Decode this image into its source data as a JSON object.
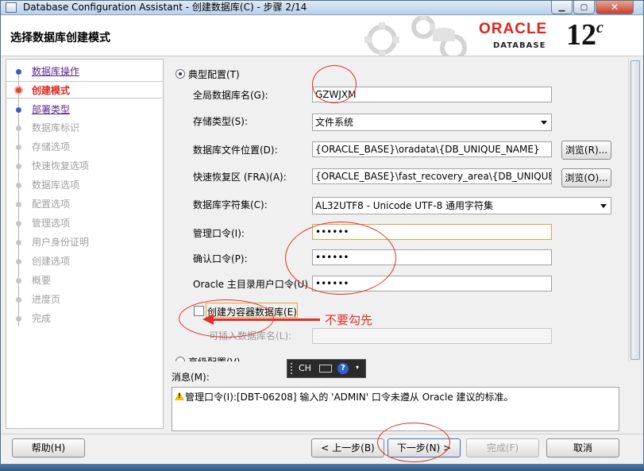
{
  "window": {
    "title": "Database Configuration Assistant - 创建数据库(C) - 步骤 2/14"
  },
  "header": {
    "page_title": "选择数据库创建模式",
    "brand": "ORACLE",
    "brand_sub": "DATABASE",
    "version_num": "12",
    "version_suffix": "c"
  },
  "steps": [
    {
      "label": "数据库操作",
      "state": "done"
    },
    {
      "label": "创建模式",
      "state": "current"
    },
    {
      "label": "部署类型",
      "state": "done"
    },
    {
      "label": "数据库标识",
      "state": "pending"
    },
    {
      "label": "存储选项",
      "state": "pending"
    },
    {
      "label": "快速恢复选项",
      "state": "pending"
    },
    {
      "label": "数据库选项",
      "state": "pending"
    },
    {
      "label": "配置选项",
      "state": "pending"
    },
    {
      "label": "管理选项",
      "state": "pending"
    },
    {
      "label": "用户身份证明",
      "state": "pending"
    },
    {
      "label": "创建选项",
      "state": "pending"
    },
    {
      "label": "概要",
      "state": "pending"
    },
    {
      "label": "进度页",
      "state": "pending"
    },
    {
      "label": "完成",
      "state": "pending"
    }
  ],
  "form": {
    "typical_label": "典型配置(T)",
    "global_db_name_label": "全局数据库名(G):",
    "global_db_name_value": "GZWJXM",
    "storage_type_label": "存储类型(S):",
    "storage_type_value": "文件系统",
    "db_file_location_label": "数据库文件位置(D):",
    "db_file_location_value": "{ORACLE_BASE}\\oradata\\{DB_UNIQUE_NAME}",
    "fra_label": "快速恢复区 (FRA)(A):",
    "fra_value": "{ORACLE_BASE}\\fast_recovery_area\\{DB_UNIQUE_NAME}",
    "browse_label": "浏览(R)...",
    "browse2_label": "浏览(O)...",
    "charset_label": "数据库字符集(C):",
    "charset_value": "AL32UTF8 - Unicode UTF-8 通用字符集",
    "admin_pwd_label": "管理口令(I):",
    "admin_pwd_value": "••••••",
    "confirm_pwd_label": "确认口令(P):",
    "confirm_pwd_value": "••••••",
    "home_pwd_label": "Oracle 主目录用户口令(U)",
    "home_pwd_value": "••••••",
    "container_label": "创建为容器数据库(E)",
    "pluggable_label": "可插入数据库名(L):",
    "advanced_label": "高级配置(V)"
  },
  "annotation": {
    "note": "不要勾先"
  },
  "ime": {
    "text": "CH",
    "help": "?"
  },
  "messages": {
    "label": "消息(M):",
    "text": "管理口令(I):[DBT-06208] 输入的 'ADMIN' 口令未遵从 Oracle 建议的标准。"
  },
  "buttons": {
    "help": "帮助(H)",
    "back": "< 上一步(B)",
    "next": "下一步(N) >",
    "finish": "完成(F)",
    "cancel": "取消"
  },
  "colors": {
    "accent_red": "#e0302a",
    "oracle_red": "#e2231a",
    "focus_orange": "#e8a33a"
  }
}
